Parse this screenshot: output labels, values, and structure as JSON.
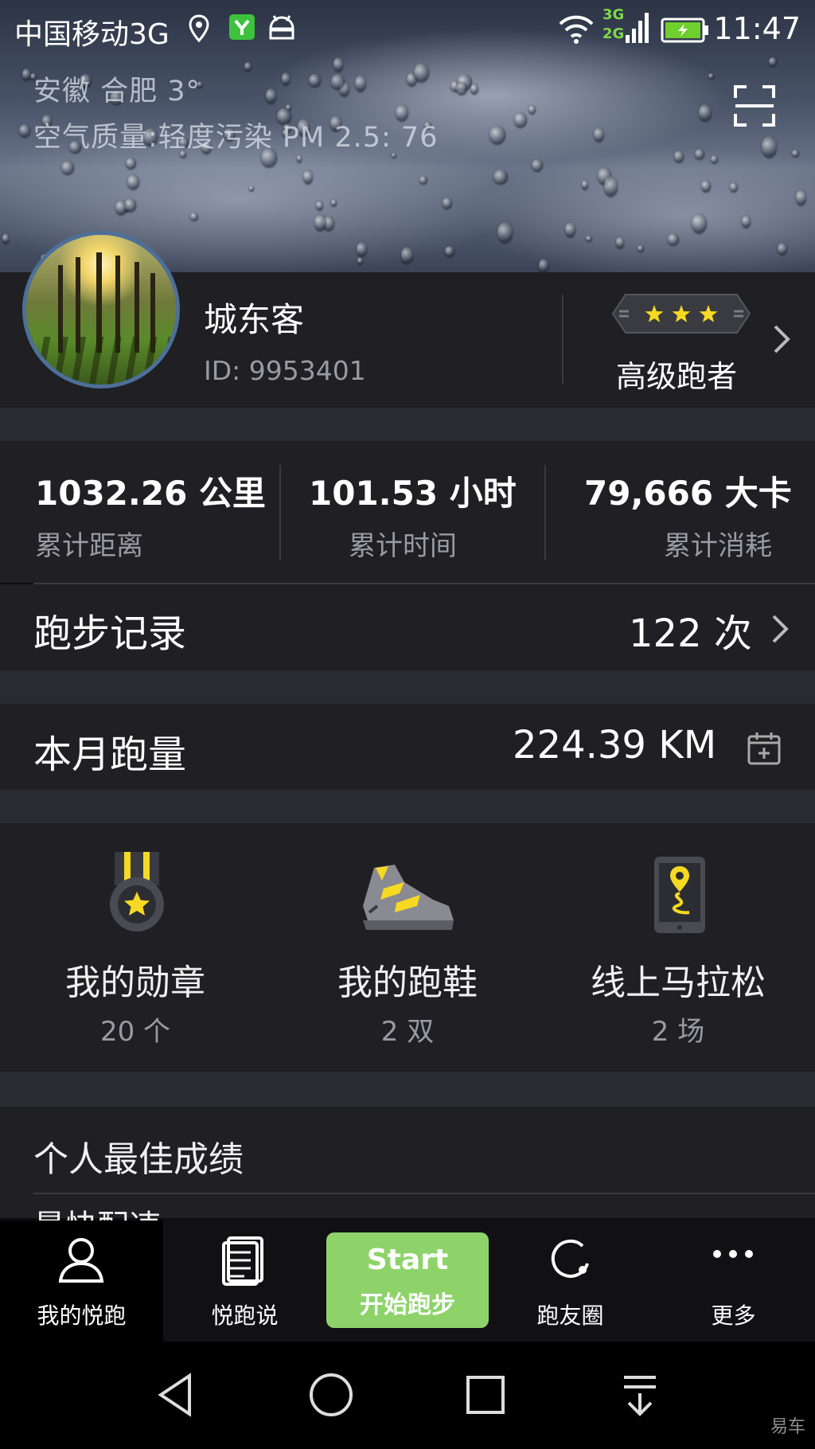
{
  "status_bar": {
    "carrier": "中国移动3G",
    "network_top": "3G",
    "network_bottom": "2G",
    "time": "11:47"
  },
  "weather": {
    "location": "安徽   合肥         3°",
    "air_quality": "空气质量:轻度污染     PM 2.5: 76"
  },
  "profile": {
    "username": "城东客",
    "user_id": "ID: 9953401",
    "rank": "高级跑者",
    "rank_stars": 3
  },
  "stats": [
    {
      "value": "1032.26 公里",
      "label": "累计距离"
    },
    {
      "value": "101.53 小时",
      "label": "累计时间"
    },
    {
      "value": "79,666 大卡",
      "label": "累计消耗"
    }
  ],
  "run_records": {
    "title": "跑步记录",
    "value": "122 次"
  },
  "monthly": {
    "title": "本月跑量",
    "value": "224.39 KM"
  },
  "tiles": [
    {
      "title": "我的勋章",
      "count": "20 个",
      "icon": "medal-icon"
    },
    {
      "title": "我的跑鞋",
      "count": "2 双",
      "icon": "running-shoe-icon"
    },
    {
      "title": "线上马拉松",
      "count": "2 场",
      "icon": "phone-map-pin-icon"
    }
  ],
  "personal_best": {
    "title": "个人最佳成绩",
    "first_item": "最快配速"
  },
  "tabbar": {
    "tabs": [
      {
        "label": "我的悦跑",
        "icon": "user-icon",
        "active": true
      },
      {
        "label": "悦跑说",
        "icon": "document-icon",
        "active": false
      },
      {
        "label": "跑友圈",
        "icon": "circle-icon",
        "active": false
      },
      {
        "label": "更多",
        "icon": "more-dots-icon",
        "active": false
      }
    ],
    "start_en": "Start",
    "start_cn": "开始跑步"
  },
  "watermark": "易车",
  "colors": {
    "background": "#1f1f24",
    "separator": "#2a2b30",
    "accent_green": "#8dd36a",
    "star_yellow": "#f5d922",
    "muted_text": "#9a9aa2"
  }
}
